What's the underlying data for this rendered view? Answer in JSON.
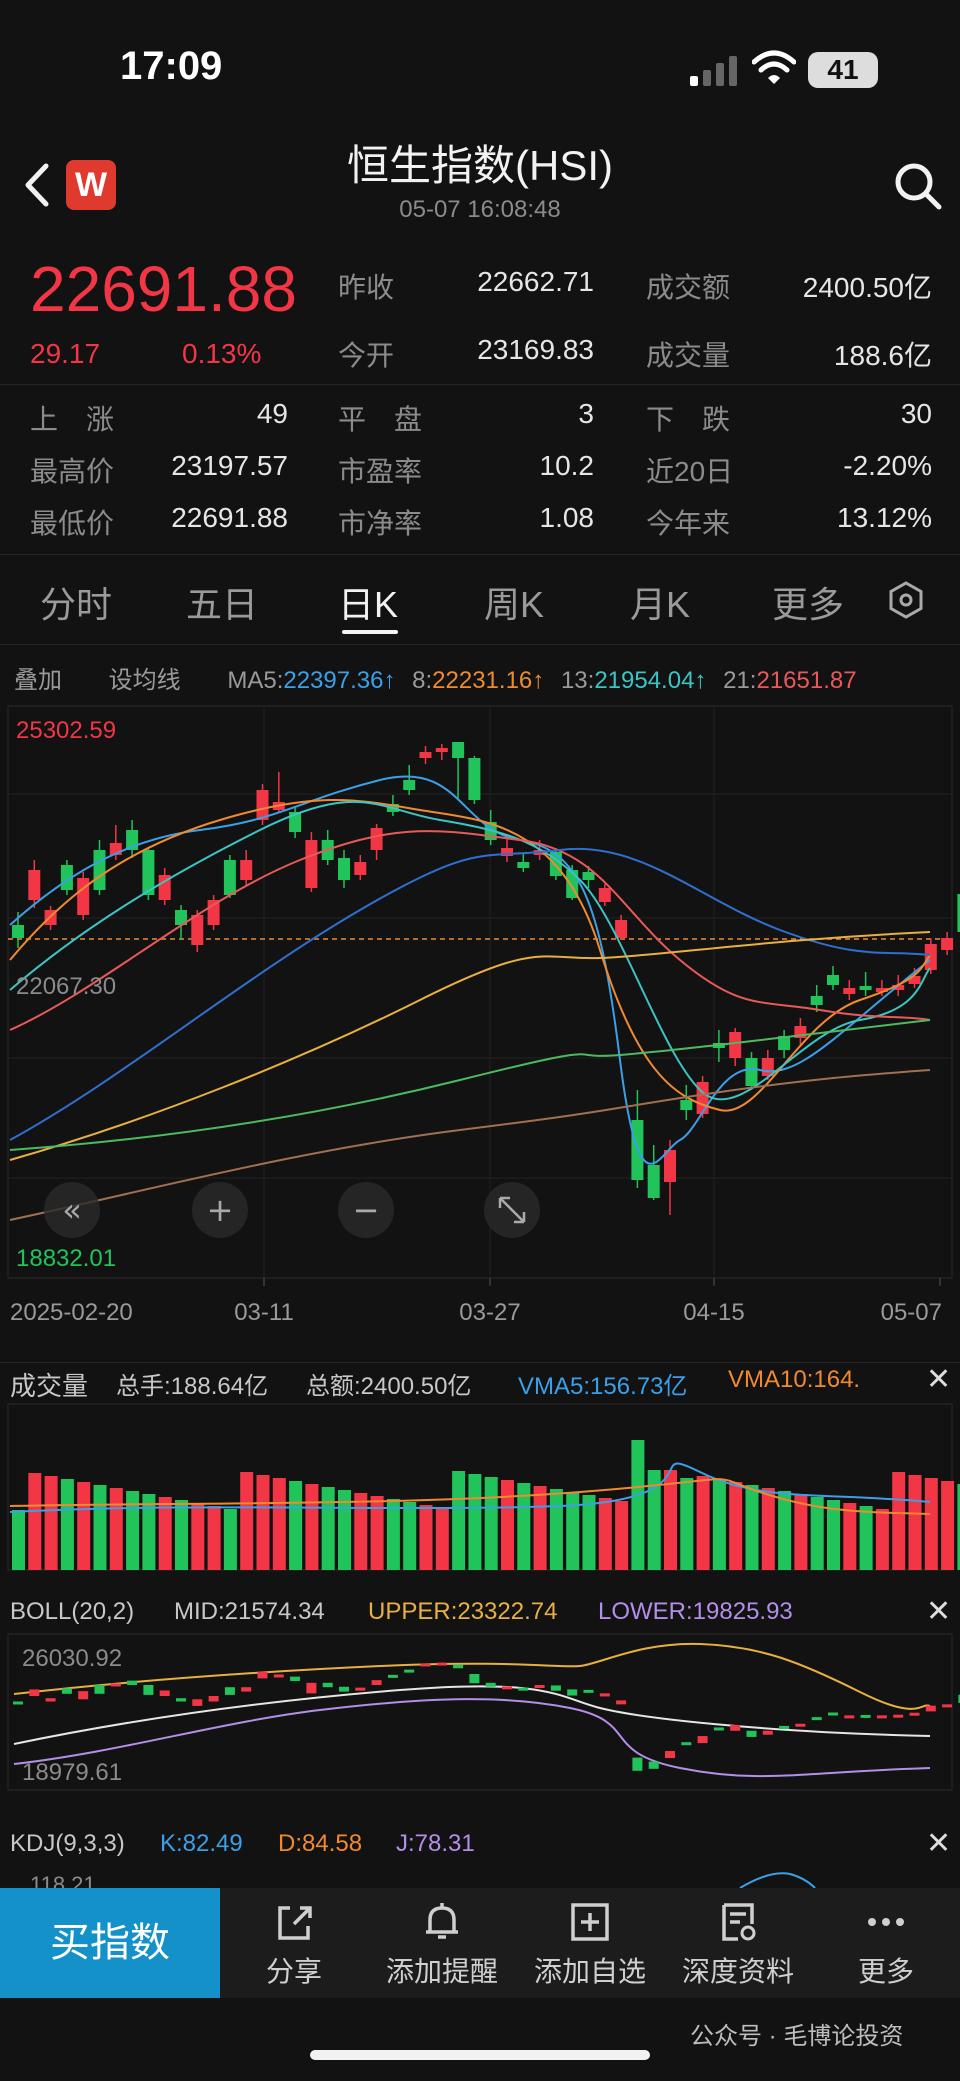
{
  "status": {
    "time": "17:09",
    "battery": "41"
  },
  "header": {
    "title": "恒生指数(HSI)",
    "timestamp": "05-07  16:08:48",
    "logo": "W"
  },
  "quote": {
    "price": "22691.88",
    "change": "29.17",
    "change_pct": "0.13%",
    "items": [
      {
        "label": "昨收",
        "value": "22662.71"
      },
      {
        "label": "成交额",
        "value": "2400.50亿"
      },
      {
        "label": "今开",
        "value": "23169.83"
      },
      {
        "label": "成交量",
        "value": "188.6亿"
      }
    ]
  },
  "stats": [
    {
      "label": "上　涨",
      "value": "49"
    },
    {
      "label": "平　盘",
      "value": "3"
    },
    {
      "label": "下　跌",
      "value": "30"
    },
    {
      "label": "最高价",
      "value": "23197.57"
    },
    {
      "label": "市盈率",
      "value": "10.2"
    },
    {
      "label": "近20日",
      "value": "-2.20%"
    },
    {
      "label": "最低价",
      "value": "22691.88"
    },
    {
      "label": "市净率",
      "value": "1.08"
    },
    {
      "label": "今年来",
      "value": "13.12%"
    }
  ],
  "tabs": [
    "分时",
    "五日",
    "日K",
    "周K",
    "月K",
    "更多"
  ],
  "ma": {
    "overlay": "叠加",
    "set_ma": "设均线",
    "ma5_label": "MA5:",
    "ma5": "22397.36↑",
    "ma8_label": "8:",
    "ma8": "22231.16↑",
    "ma13_label": "13:",
    "ma13": "21954.04↑",
    "ma21_label": "21:",
    "ma21": "21651.87"
  },
  "kchart": {
    "high_label": "25302.59",
    "low_label": "18832.01",
    "ref_label": "22067.30",
    "dates": [
      "2025-02-20",
      "03-11",
      "03-27",
      "04-15",
      "05-07"
    ],
    "colors": {
      "up": "#f23645",
      "down": "#21c35b",
      "ma5": "#3aa0e8",
      "ma8": "#f08a30",
      "ma13": "#3cc4c4",
      "ma21": "#e85a5a",
      "ma60": "#2f6fd0",
      "ma120": "#e8b040",
      "ma250": "#4cba60",
      "ma_long": "#a07050"
    }
  },
  "volume": {
    "title": "成交量",
    "total_hands": "总手:188.64亿",
    "total_amount": "总额:2400.50亿",
    "vma5": "VMA5:156.73亿",
    "vma10": "VMA10:164."
  },
  "boll": {
    "title": "BOLL(20,2)",
    "mid": "MID:21574.34",
    "upper": "UPPER:23322.74",
    "lower": "LOWER:19825.93",
    "high_label": "26030.92",
    "low_label": "18979.61"
  },
  "kdj": {
    "title": "KDJ(9,3,3)",
    "k": "K:82.49",
    "d": "D:84.58",
    "j": "J:78.31",
    "axis": "118.21"
  },
  "bottom": {
    "buy": "买指数",
    "items": [
      {
        "label": "分享",
        "icon": "share-icon"
      },
      {
        "label": "添加提醒",
        "icon": "bell-icon"
      },
      {
        "label": "添加自选",
        "icon": "plus-square-icon"
      },
      {
        "label": "深度资料",
        "icon": "document-icon"
      },
      {
        "label": "更多",
        "icon": "more-icon"
      }
    ]
  },
  "watermark": "公众号 · 毛博论投资"
}
